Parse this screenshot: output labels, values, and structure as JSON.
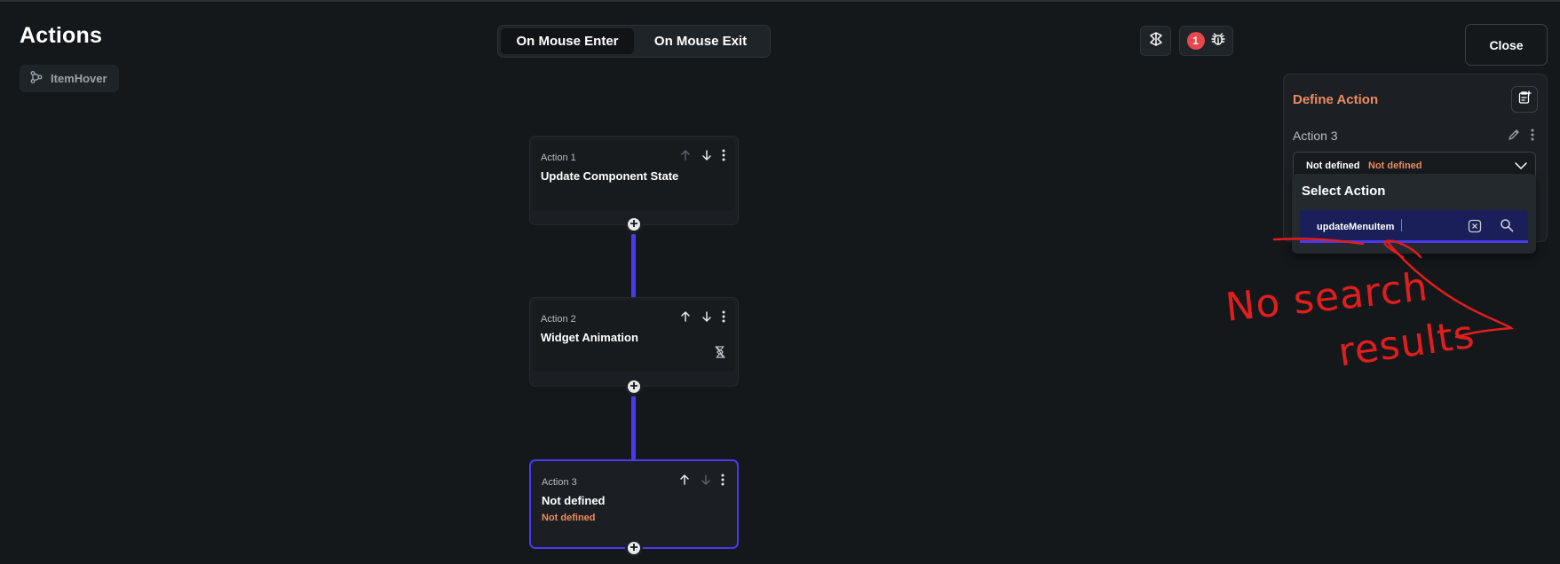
{
  "header": {
    "title": "Actions",
    "chip_label": "ItemHover"
  },
  "trigger_tabs": [
    {
      "label": "On Mouse Enter",
      "active": true
    },
    {
      "label": "On Mouse Exit",
      "active": false
    }
  ],
  "toolbar": {
    "flutterflow_icon": "flutterflow-icon",
    "debug_badge_count": "1",
    "debug_icon": "bug-icon",
    "close_label": "Close"
  },
  "actions": [
    {
      "number": "Action 1",
      "title": "Update Component State",
      "subtitle": ""
    },
    {
      "number": "Action 2",
      "title": "Widget Animation",
      "subtitle": ""
    },
    {
      "number": "Action 3",
      "title": "Not defined",
      "subtitle": "Not defined"
    }
  ],
  "define_panel": {
    "title": "Define Action",
    "action_label": "Action 3",
    "select_value": "Not defined",
    "select_value_secondary": "Not defined"
  },
  "dropdown": {
    "title": "Select Action",
    "search_value": "updateMenuItem"
  },
  "annotation": {
    "line1": "No search",
    "line2": "results"
  },
  "colors": {
    "accent": "#4b39ef",
    "warning_text": "#ee8b60",
    "annotation": "#e11d1d",
    "badge": "#e5484d"
  }
}
